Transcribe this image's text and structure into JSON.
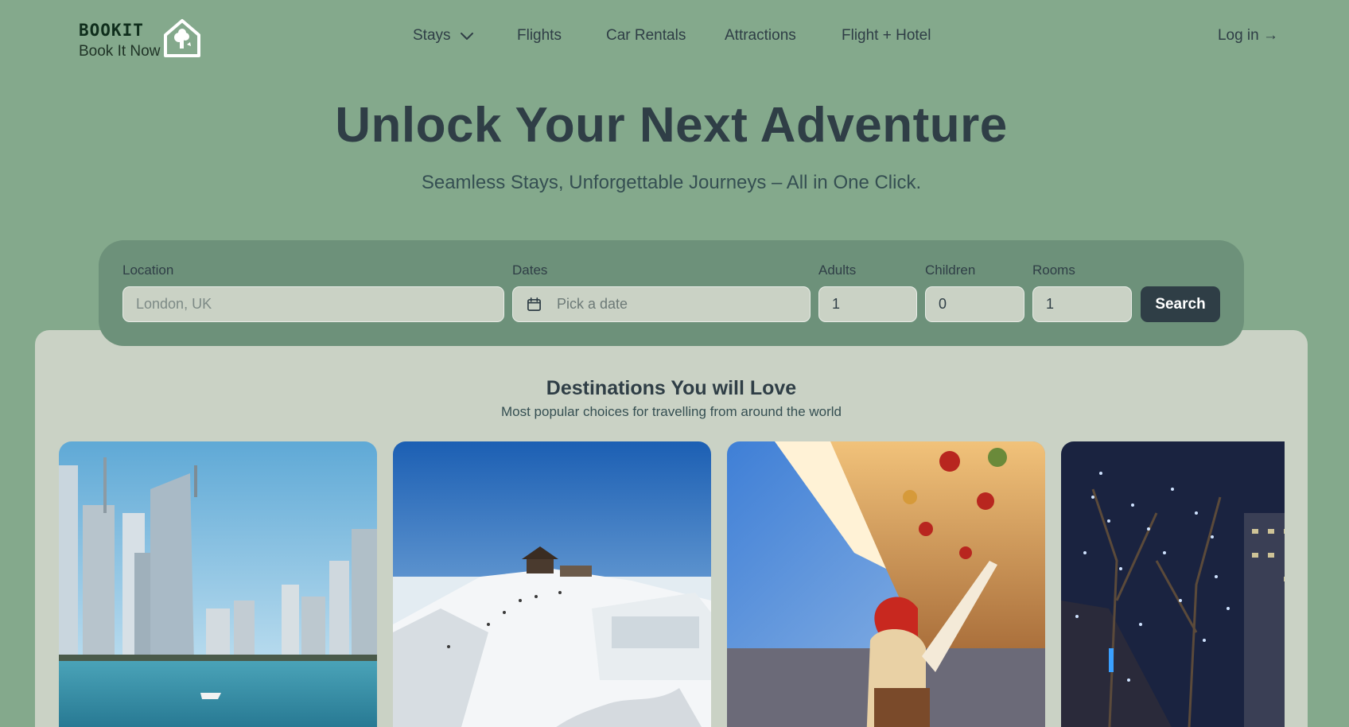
{
  "logo": {
    "brand": "BOOKIT",
    "tagline": "Book It Now"
  },
  "nav": {
    "items": [
      {
        "label": "Stays",
        "has_dropdown": true
      },
      {
        "label": "Flights"
      },
      {
        "label": "Car Rentals"
      },
      {
        "label": "Attractions"
      },
      {
        "label": "Flight + Hotel"
      }
    ],
    "login": "Log in →"
  },
  "hero": {
    "title": "Unlock Your Next Adventure",
    "subtitle": "Seamless Stays, Unforgettable Journeys – All in One Click."
  },
  "search": {
    "location_label": "Location",
    "location_placeholder": "London, UK",
    "dates_label": "Dates",
    "dates_placeholder": "Pick a date",
    "adults_label": "Adults",
    "adults_value": "1",
    "children_label": "Children",
    "children_value": "0",
    "rooms_label": "Rooms",
    "rooms_value": "1",
    "button": "Search"
  },
  "destinations": {
    "title": "Destinations You will Love",
    "subtitle": "Most popular choices for travelling from around the world",
    "cards": [
      {
        "image": "city-marina-skyline"
      },
      {
        "image": "snowy-mountain-temple"
      },
      {
        "image": "christmas-market-ornaments"
      },
      {
        "image": "illuminated-night-street-trees"
      }
    ]
  },
  "colors": {
    "background": "#84a98c",
    "panel": "#cad2c5",
    "search_bar": "#6d917a",
    "dark": "#2f3e46",
    "logo_text": "#0f2e1c"
  }
}
